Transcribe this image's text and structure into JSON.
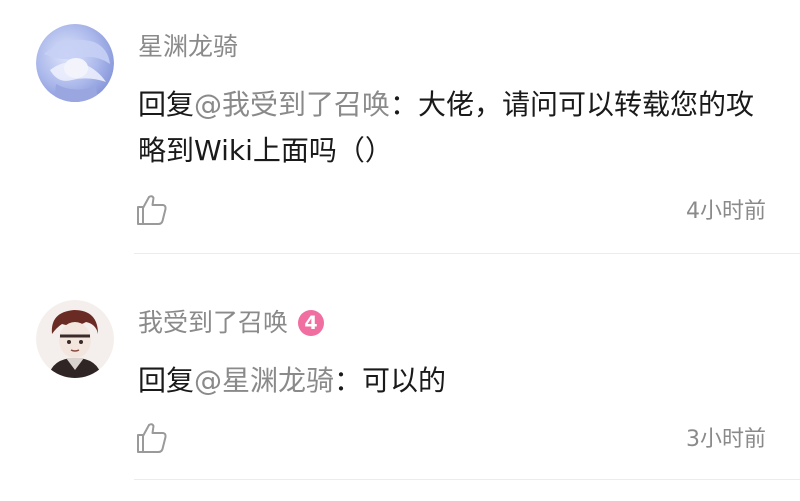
{
  "comments": [
    {
      "username": "星渊龙骑",
      "reply_prefix": "回复",
      "mention": "@我受到了召唤",
      "separator": "：",
      "body": "大佬，请问可以转载您的攻略到Wiki上面吗（）",
      "timestamp": "4小时前",
      "avatar": "anime-character-avatar-light-blue"
    },
    {
      "username": "我受到了召唤",
      "level_badge": "4",
      "reply_prefix": "回复",
      "mention": "@星渊龙骑",
      "separator": "：",
      "body": "可以的",
      "timestamp": "3小时前",
      "avatar": "anime-character-avatar-dark-red"
    }
  ],
  "colors": {
    "username": "#8a8a8a",
    "mention": "#8a8a8a",
    "body": "#1a1a1a",
    "level_badge": "#f06ea0",
    "divider": "#ececec"
  },
  "icons": {
    "like": "thumbs-up-icon"
  }
}
